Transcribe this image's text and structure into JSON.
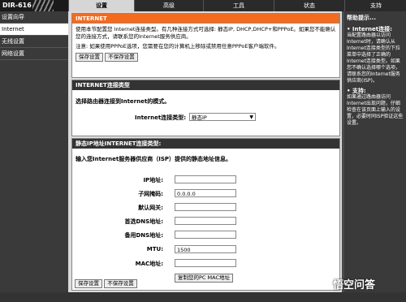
{
  "header": {
    "model": "DIR-616",
    "tabs": [
      "设置",
      "高级",
      "工具",
      "状态",
      "支持"
    ]
  },
  "sidebar": {
    "items": [
      "设置向导",
      "Internet",
      "无线设置",
      "网络设置"
    ]
  },
  "internet": {
    "title": "INTERNET",
    "desc": "使用本节配置您 Internet连接类型。有几种连接方式可选择: 静态IP, DHCP,DHCP+和PPPoE。如果您不能确认您的连接方式，请联系您的Internet服务供应商。",
    "note": "注意: 如果使用PPPoE选项，您需要在您的计算机上移除或禁用任意PPPoE客户端软件。",
    "save": "保存设置",
    "nosave": "不保存设置"
  },
  "conn": {
    "title": "INTERNET连接类型",
    "desc": "选择路由器连接到Internet的模式。",
    "label": "Internet连接类型:",
    "value": "静态IP"
  },
  "static": {
    "title": "静态IP地址INTERNET连接类型:",
    "desc": "输入您Internet服务器供应商（ISP）提供的静态地址信息。",
    "fields": [
      {
        "label": "IP地址:",
        "value": ""
      },
      {
        "label": "子网掩码:",
        "value": "0.0.0.0"
      },
      {
        "label": "默认网关:",
        "value": ""
      },
      {
        "label": "首选DNS地址:",
        "value": ""
      },
      {
        "label": "备用DNS地址:",
        "value": ""
      },
      {
        "label": "MTU:",
        "value": "1500"
      },
      {
        "label": "MAC地址:",
        "value": ""
      }
    ],
    "clone": "复制您的PC MAC地址",
    "save": "保存设置",
    "nosave": "不保存设置"
  },
  "help": {
    "title": "帮助提示...",
    "b1_title": "• Internet连接:",
    "b1_text": "当配置路由器以访问Internet时，请确认从Internet连接类型的下拉菜单中选择了正确的Internet连接类型。如果您不确认选择哪个选项，请联系您的Internet服务供应商(ISP)。",
    "b2_title": "• 支持:",
    "b2_text": "如果通过路由器访问Internet出现问题，仔细检查在该页面上输入的设置，必要时同ISP验证这些设置。"
  },
  "watermark": "悟空问答"
}
